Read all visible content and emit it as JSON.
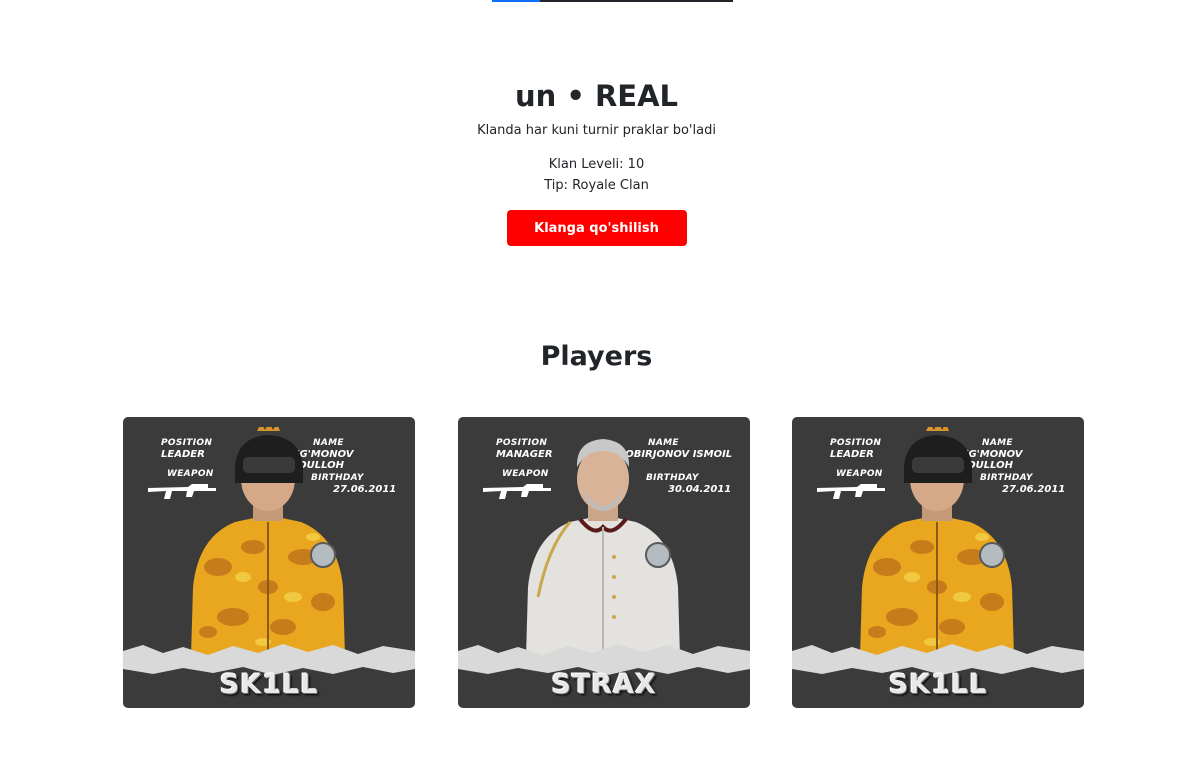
{
  "clan": {
    "title": "un • REAL",
    "description": "Klanda har kuni turnir praklar bo'ladi",
    "level": "Klan Leveli: 10",
    "type": "Tip: Royale Clan",
    "join_label": "Klanga qo'shilish"
  },
  "players_heading": "Players",
  "players": [
    {
      "position_label": "POSITION",
      "position": "LEADER",
      "weapon_label": "WEAPON",
      "name_label": "NAME",
      "name": "NUG'MONOV ABDULLOH",
      "birthday_label": "BIRTHDAY",
      "birthday": "27.06.2011",
      "nickname": "SK1LL",
      "outfit": "yellow-camo-jacket"
    },
    {
      "position_label": "POSITION",
      "position": "MANAGER",
      "weapon_label": "WEAPON",
      "name_label": "NAME",
      "name": "SOBIRJONOV ISMOIL",
      "birthday_label": "BIRTHDAY",
      "birthday": "30.04.2011",
      "nickname": "STRAX",
      "outfit": "white-uniform"
    },
    {
      "position_label": "POSITION",
      "position": "LEADER",
      "weapon_label": "WEAPON",
      "name_label": "NAME",
      "name": "NUG'MONOV ABDULLOH",
      "birthday_label": "BIRTHDAY",
      "birthday": "27.06.2011",
      "nickname": "SK1LL",
      "outfit": "yellow-camo-jacket"
    }
  ],
  "colors": {
    "join_button": "#ff0000",
    "card_background": "#3b3b3b",
    "progress_fill": "#0d6efd"
  },
  "scroll_progress": 0.2
}
